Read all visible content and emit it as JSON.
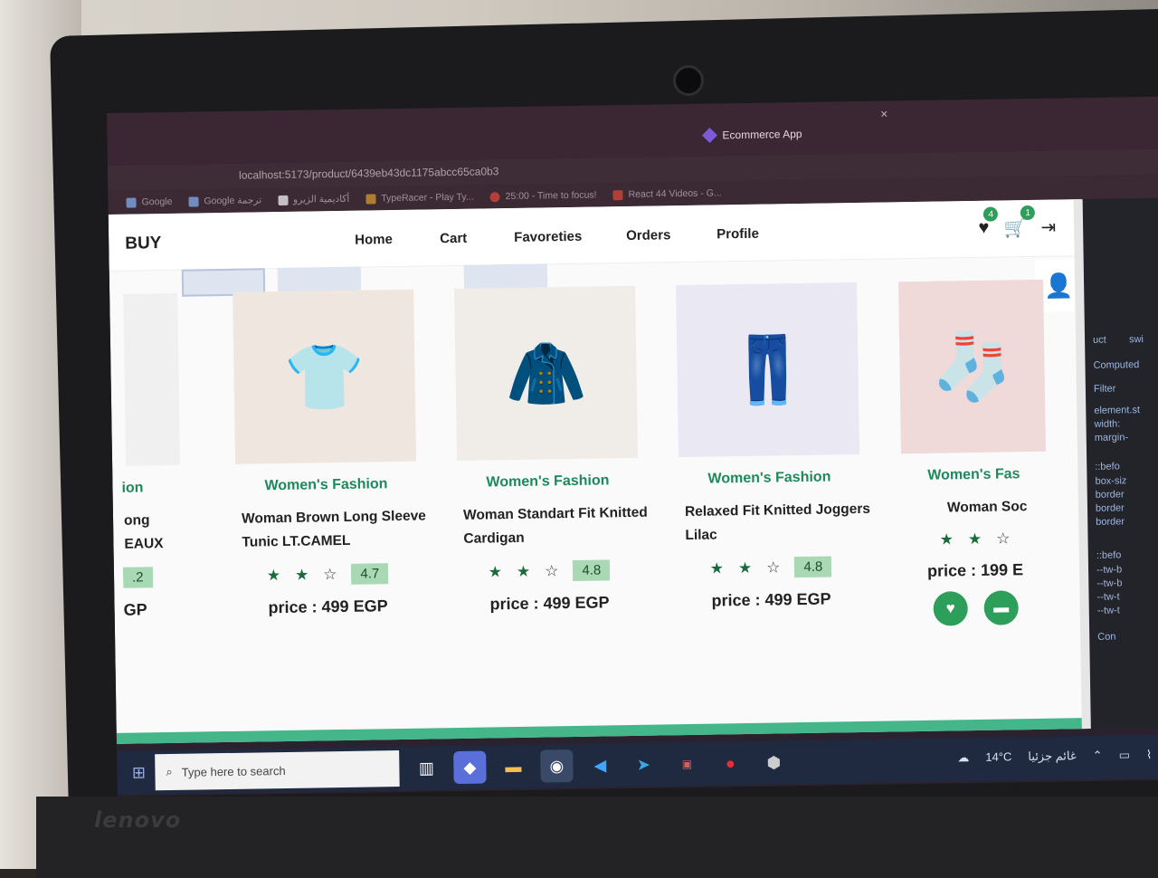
{
  "browser": {
    "tabs": [
      {
        "label": "Ecommerce App",
        "active": true
      }
    ],
    "tab_close": "×",
    "url": "localhost:5173/product/6439eb43dc1175abcc65ca0b3",
    "bookmarks": [
      {
        "label": "Google",
        "color": "#4285f4"
      },
      {
        "label": "Google ترجمة",
        "color": "#4285f4"
      },
      {
        "label": "أكاديمية الزيرو",
        "color": "#ffffff"
      },
      {
        "label": "TypeRacer - Play Ty...",
        "color": "#e0a030"
      },
      {
        "label": "25:00 - Time to focus!",
        "color": "#e24a3c"
      },
      {
        "label": "React 44 Videos - G...",
        "color": "#e24a3c"
      }
    ]
  },
  "nav": {
    "brand": "BUY",
    "links": [
      "Home",
      "Cart",
      "Favoreties",
      "Orders",
      "Profile"
    ],
    "icons": [
      {
        "name": "heart-icon",
        "glyph": "♥",
        "badge": "4"
      },
      {
        "name": "cart-icon",
        "glyph": "🛒",
        "badge": "1"
      },
      {
        "name": "logout-icon",
        "glyph": "⇥",
        "badge": ""
      }
    ]
  },
  "partial_card": {
    "cat": "ion",
    "line1": "ong",
    "line2": "EAUX",
    "rating": ".2",
    "price": "GP"
  },
  "products": [
    {
      "category": "Women's Fashion",
      "title": "Woman Brown Long Sleeve Tunic LT.CAMEL",
      "stars_filled": 2,
      "stars_empty": 1,
      "rating": "4.7",
      "price": "price : 499 EGP",
      "icon": "👕",
      "bg": "#c9a08a"
    },
    {
      "category": "Women's Fashion",
      "title": "Woman Standart Fit Knitted Cardigan",
      "stars_filled": 2,
      "stars_empty": 1,
      "rating": "4.8",
      "price": "price : 499 EGP",
      "icon": "🧥",
      "bg": "#ebe3d6"
    },
    {
      "category": "Women's Fashion",
      "title": "Relaxed Fit Knitted Joggers Lilac",
      "stars_filled": 2,
      "stars_empty": 1,
      "rating": "4.8",
      "price": "price : 499 EGP",
      "icon": "👖",
      "bg": "#c7c5ea"
    },
    {
      "category": "Women's Fas",
      "title": "Woman Soc",
      "stars_filled": 2,
      "stars_empty": 1,
      "rating": "",
      "price": "price : 199 E",
      "icon": "🧦",
      "bg": "#e8c9c9"
    }
  ],
  "devtools": {
    "items": [
      "uct",
      "swi",
      "Computed",
      "Filter",
      "element.st",
      "width:",
      "margin-",
      "::befo",
      "box-siz",
      "border",
      "border",
      "border",
      "::befo",
      "--tw-b",
      "--tw-b",
      "--tw-t",
      "--tw-t",
      "Con"
    ]
  },
  "taskbar": {
    "search_placeholder": "Type here to search",
    "temperature": "14°C",
    "weather": "غائم جزئيا",
    "apps": [
      "task-view",
      "copilot",
      "file-explorer",
      "chrome",
      "vscode",
      "telegram",
      "app-2018",
      "record",
      "virtualbox"
    ],
    "tray_badge": "1"
  },
  "colors": {
    "accent": "#2e9e5b",
    "category_text": "#1c8a5c",
    "rating_bg": "#a9d9b4",
    "profile_icon": "#16806f"
  }
}
